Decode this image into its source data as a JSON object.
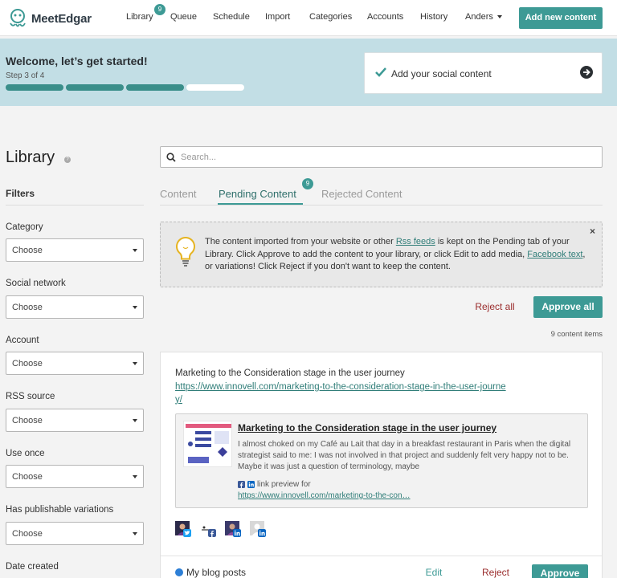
{
  "app": {
    "logo_text": "MeetEdgar"
  },
  "nav": {
    "library": "Library",
    "library_badge": "9",
    "queue": "Queue",
    "schedule": "Schedule",
    "import": "Import",
    "categories": "Categories",
    "accounts": "Accounts",
    "history": "History",
    "user": "Anders",
    "add_new": "Add new content"
  },
  "welcome": {
    "title": "Welcome, let’s get started!",
    "step": "Step 3 of 4",
    "progress_completed": 3,
    "progress_total": 4,
    "task": "Add your social content"
  },
  "sidebar": {
    "title": "Library",
    "filters_title": "Filters",
    "filters": [
      {
        "label": "Category",
        "value": "Choose"
      },
      {
        "label": "Social network",
        "value": "Choose"
      },
      {
        "label": "Account",
        "value": "Choose"
      },
      {
        "label": "RSS source",
        "value": "Choose"
      },
      {
        "label": "Use once",
        "value": "Choose"
      },
      {
        "label": "Has publishable variations",
        "value": "Choose"
      },
      {
        "label": "Date created",
        "value": ""
      }
    ]
  },
  "search": {
    "placeholder": "Search..."
  },
  "tabs": {
    "content": "Content",
    "pending": "Pending Content",
    "pending_badge": "9",
    "rejected": "Rejected Content"
  },
  "info": {
    "t1": "The content imported from your website or other ",
    "link1": "Rss feeds",
    "t2": " is kept on the Pending tab of your Library. Click Approve to add the content to your library, or click Edit to add media, ",
    "link2": "Facebook text",
    "t3": ", or variations! Click Reject if you don't want to keep the content.",
    "close": "×"
  },
  "actions": {
    "reject_all": "Reject all",
    "approve_all": "Approve all",
    "count": "9 content items"
  },
  "item": {
    "title": "Marketing to the Consideration stage in the user journey",
    "url": "https://www.innovell.com/marketing-to-the-consideration-stage-in-the-user-journey/",
    "preview": {
      "title": "Marketing to the Consideration stage in the user journey",
      "description": "I almost choked on my Café au Lait that day in a breakfast restaurant in Paris when the digital strategist said to me: I was not involved in that project and suddenly felt very happy not to be. Maybe it was just a question of terminology, maybe",
      "link_preview_label": "link preview for",
      "link": "https://www.innovell.com/marketing-to-the-con…"
    },
    "category": "My blog posts",
    "category_color": "#2d7fd6",
    "edit": "Edit",
    "reject": "Reject",
    "approve": "Approve"
  },
  "colors": {
    "accent": "#3d9a95",
    "danger": "#9a2c2c",
    "banner": "#c2dee5"
  }
}
